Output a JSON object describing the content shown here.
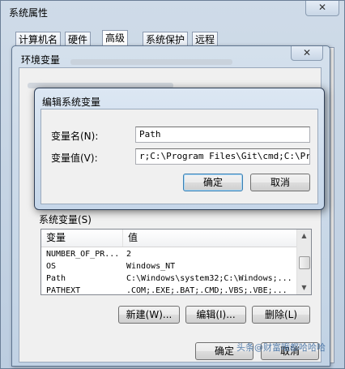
{
  "system_properties": {
    "title": "系统属性",
    "close_glyph": "✕",
    "tabs": [
      "计算机名",
      "硬件",
      "高级",
      "系统保护",
      "远程"
    ],
    "active_tab": "高级"
  },
  "env_window": {
    "title": "环境变量",
    "close_glyph": "✕",
    "system_vars_label": "系统变量(S)",
    "columns": [
      "变量",
      "值"
    ],
    "rows": [
      {
        "name": "NUMBER_OF_PR...",
        "value": "2"
      },
      {
        "name": "OS",
        "value": "Windows_NT"
      },
      {
        "name": "Path",
        "value": "C:\\Windows\\system32;C:\\Windows;..."
      },
      {
        "name": "PATHEXT",
        "value": ".COM;.EXE;.BAT;.CMD;.VBS;.VBE;..."
      }
    ],
    "buttons": {
      "new": "新建(W)...",
      "edit": "编辑(I)...",
      "delete": "删除(L)"
    },
    "ok": "确定",
    "cancel": "取消"
  },
  "edit_dialog": {
    "title": "编辑系统变量",
    "name_label": "变量名(N):",
    "value_label": "变量值(V):",
    "name_value": "Path",
    "value_value": "r;C:\\Program Files\\Git\\cmd;C:\\Progr",
    "ok": "确定",
    "cancel": "取消"
  },
  "watermark": "头条@财富哦都哈哈哈"
}
